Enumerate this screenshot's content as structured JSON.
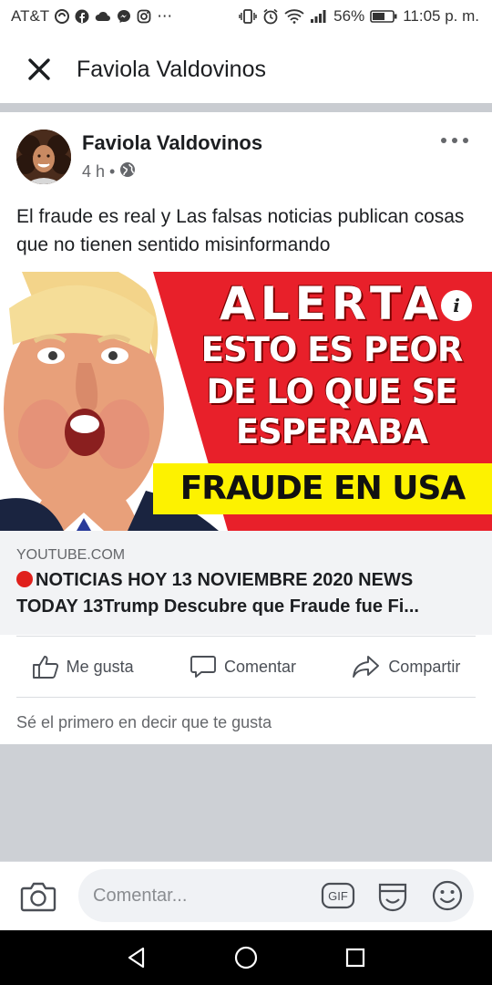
{
  "status_bar": {
    "carrier": "AT&T",
    "battery": "56%",
    "time": "11:05 p. m.",
    "more": "⋯"
  },
  "header": {
    "title": "Faviola Valdovinos",
    "close_icon": "close-icon"
  },
  "post": {
    "author": "Faviola Valdovinos",
    "time": "4 h",
    "dot": "•",
    "privacy_icon": "globe-icon",
    "text": "El fraude es real y Las falsas noticias publican cosas que no tienen sentido misinformando",
    "link": {
      "image_text": {
        "line1": "ALERTA",
        "line2": "ESTO ES PEOR",
        "line3": "DE LO QUE SE",
        "line4": "ESPERABA",
        "band": "FRAUDE EN USA"
      },
      "info": "i",
      "domain": "YOUTUBE.COM",
      "title_line1": "NOTICIAS HOY 13 NOVIEMBRE 2020 NEWS",
      "title_line2": "TODAY 13Trump Descubre que Fraude fue Fi..."
    },
    "actions": {
      "like": "Me gusta",
      "comment": "Comentar",
      "share": "Compartir"
    },
    "first_like": "Sé el primero en decir que te gusta"
  },
  "comment_bar": {
    "placeholder": "Comentar...",
    "gif_label": "GIF"
  },
  "colors": {
    "image_red": "#e8202a",
    "band_yellow": "#fdf200",
    "text_primary": "#1c1e21",
    "text_secondary": "#65676b",
    "feed_grey": "#cdd0d5"
  }
}
